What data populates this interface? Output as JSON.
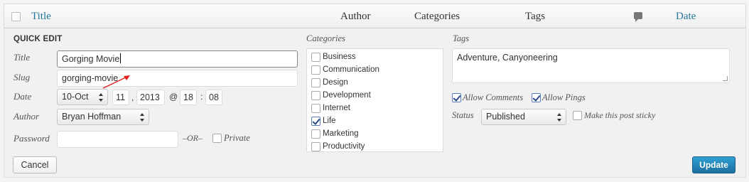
{
  "header": {
    "columns": {
      "title": "Title",
      "author": "Author",
      "categories": "Categories",
      "tags": "Tags",
      "date": "Date"
    }
  },
  "quick_edit": {
    "section_title": "QUICK EDIT",
    "title": {
      "label": "Title",
      "value": "Gorging Movie"
    },
    "slug": {
      "label": "Slug",
      "value": "gorging-movie"
    },
    "date": {
      "label": "Date",
      "month": "10-Oct",
      "day": "11",
      "comma": ",",
      "year": "2013",
      "at": "@",
      "hour": "18",
      "colon": ":",
      "minute": "08"
    },
    "author": {
      "label": "Author",
      "value": "Bryan Hoffman"
    },
    "password": {
      "label": "Password",
      "value": "",
      "or_text": "–OR–",
      "private_label": "Private"
    }
  },
  "categories": {
    "label": "Categories",
    "items": [
      {
        "label": "Business",
        "checked": false
      },
      {
        "label": "Communication",
        "checked": false
      },
      {
        "label": "Design",
        "checked": false
      },
      {
        "label": "Development",
        "checked": false
      },
      {
        "label": "Internet",
        "checked": false
      },
      {
        "label": "Life",
        "checked": true
      },
      {
        "label": "Marketing",
        "checked": false
      },
      {
        "label": "Productivity",
        "checked": false
      }
    ]
  },
  "tags": {
    "label": "Tags",
    "value": "Adventure, Canyoneering"
  },
  "options": {
    "allow_comments": "Allow Comments",
    "allow_pings": "Allow Pings",
    "status_label": "Status",
    "status_value": "Published",
    "sticky_label": "Make this post sticky"
  },
  "buttons": {
    "cancel": "Cancel",
    "update": "Update"
  },
  "colors": {
    "link": "#21759b",
    "update_button": "#2284b5",
    "annotation_arrow": "#e02020"
  }
}
